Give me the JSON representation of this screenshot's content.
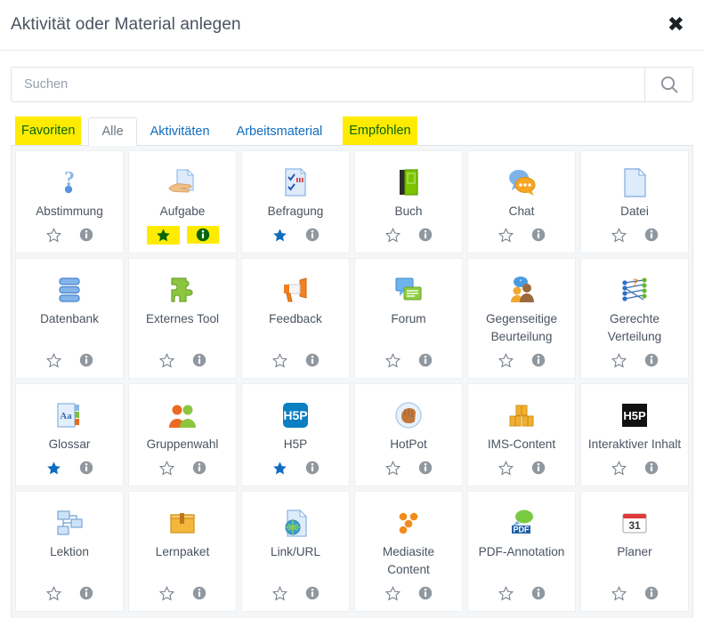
{
  "header": {
    "title": "Aktivität oder Material anlegen",
    "close_label": "✖",
    "close_icon": "close-icon"
  },
  "search": {
    "placeholder": "Suchen",
    "value": "",
    "button_icon": "search-icon"
  },
  "tabs": [
    {
      "label": "Favoriten",
      "active": false,
      "highlighted": true
    },
    {
      "label": "Alle",
      "active": true,
      "highlighted": false
    },
    {
      "label": "Aktivitäten",
      "active": false,
      "highlighted": false
    },
    {
      "label": "Arbeitsmaterial",
      "active": false,
      "highlighted": false
    },
    {
      "label": "Empfohlen",
      "active": false,
      "highlighted": true
    }
  ],
  "colors": {
    "highlight": "#ffeb00",
    "highlight_text": "#056608",
    "link": "#0f6cbf",
    "star_active": "#0f6cbf",
    "star_inactive": "#7a828c",
    "info": "#8f979f",
    "text": "#4a5360"
  },
  "cards": [
    {
      "label": "Abstimmung",
      "icon": "question-mark-icon",
      "favorite": false,
      "star_highlighted": false,
      "info_highlighted": false
    },
    {
      "label": "Aufgabe",
      "icon": "hand-document-icon",
      "favorite": true,
      "star_highlighted": true,
      "info_highlighted": true
    },
    {
      "label": "Befragung",
      "icon": "checklist-document-icon",
      "favorite": true,
      "star_highlighted": false,
      "info_highlighted": false
    },
    {
      "label": "Buch",
      "icon": "book-icon",
      "favorite": false,
      "star_highlighted": false,
      "info_highlighted": false
    },
    {
      "label": "Chat",
      "icon": "speech-bubbles-icon",
      "favorite": false,
      "star_highlighted": false,
      "info_highlighted": false
    },
    {
      "label": "Datei",
      "icon": "file-icon",
      "favorite": false,
      "star_highlighted": false,
      "info_highlighted": false
    },
    {
      "label": "Datenbank",
      "icon": "database-icon",
      "favorite": false,
      "star_highlighted": false,
      "info_highlighted": false
    },
    {
      "label": "Externes Tool",
      "icon": "puzzle-piece-icon",
      "favorite": false,
      "star_highlighted": false,
      "info_highlighted": false
    },
    {
      "label": "Feedback",
      "icon": "megaphone-icon",
      "favorite": false,
      "star_highlighted": false,
      "info_highlighted": false
    },
    {
      "label": "Forum",
      "icon": "forum-bubbles-icon",
      "favorite": false,
      "star_highlighted": false,
      "info_highlighted": false
    },
    {
      "label": "Gegenseitige Beurteilung",
      "icon": "two-people-icon",
      "favorite": false,
      "star_highlighted": false,
      "info_highlighted": false
    },
    {
      "label": "Gerechte Verteilung",
      "icon": "network-nodes-icon",
      "favorite": false,
      "star_highlighted": false,
      "info_highlighted": false
    },
    {
      "label": "Glossar",
      "icon": "glossary-aa-icon",
      "favorite": true,
      "star_highlighted": false,
      "info_highlighted": false
    },
    {
      "label": "Gruppenwahl",
      "icon": "group-people-icon",
      "favorite": false,
      "star_highlighted": false,
      "info_highlighted": false
    },
    {
      "label": "H5P",
      "icon": "h5p-blue-icon",
      "favorite": true,
      "star_highlighted": false,
      "info_highlighted": false
    },
    {
      "label": "HotPot",
      "icon": "hand-fist-icon",
      "favorite": false,
      "star_highlighted": false,
      "info_highlighted": false
    },
    {
      "label": "IMS-Content",
      "icon": "boxes-icon",
      "favorite": false,
      "star_highlighted": false,
      "info_highlighted": false
    },
    {
      "label": "Interaktiver Inhalt",
      "icon": "h5p-black-icon",
      "favorite": false,
      "star_highlighted": false,
      "info_highlighted": false
    },
    {
      "label": "Lektion",
      "icon": "flowchart-icon",
      "favorite": false,
      "star_highlighted": false,
      "info_highlighted": false
    },
    {
      "label": "Lernpaket",
      "icon": "package-box-icon",
      "favorite": false,
      "star_highlighted": false,
      "info_highlighted": false
    },
    {
      "label": "Link/URL",
      "icon": "globe-file-icon",
      "favorite": false,
      "star_highlighted": false,
      "info_highlighted": false
    },
    {
      "label": "Mediasite Content",
      "icon": "mediasite-dots-icon",
      "favorite": false,
      "star_highlighted": false,
      "info_highlighted": false
    },
    {
      "label": "PDF-Annotation",
      "icon": "pdf-bubble-icon",
      "favorite": false,
      "star_highlighted": false,
      "info_highlighted": false
    },
    {
      "label": "Planer",
      "icon": "calendar-31-icon",
      "favorite": false,
      "star_highlighted": false,
      "info_highlighted": false
    }
  ]
}
